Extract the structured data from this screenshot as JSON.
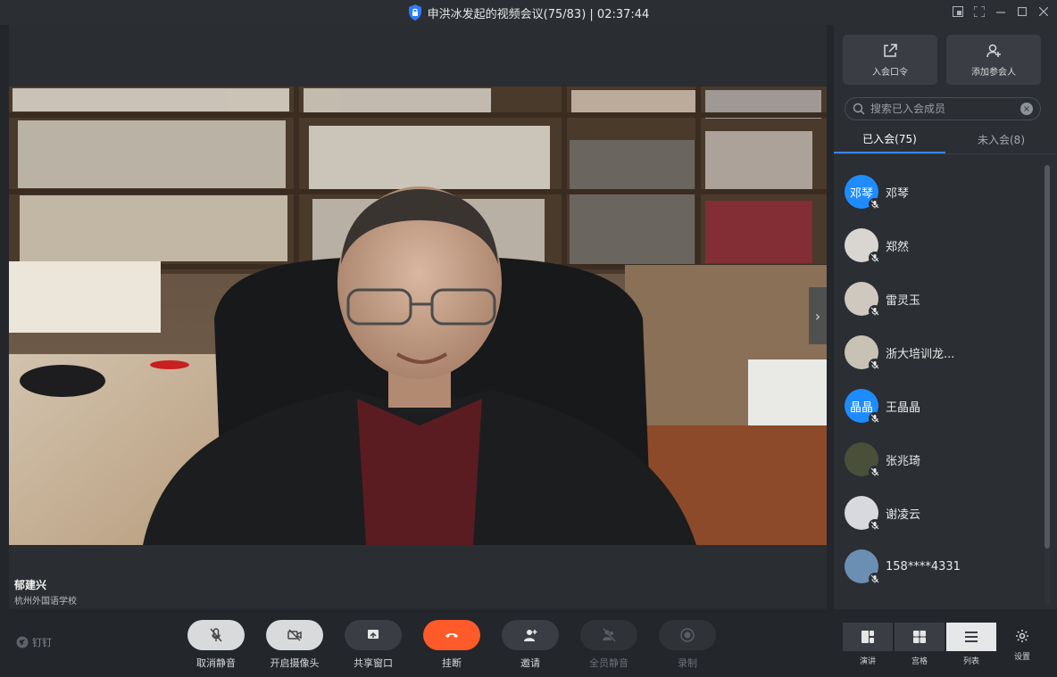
{
  "window": {
    "title": "申洪冰发起的视频会议(75/83) | 02:37:44",
    "controls": [
      "pip-icon",
      "fullscreen-icon",
      "minimize-icon",
      "maximize-icon",
      "close-icon"
    ]
  },
  "stage": {
    "speaker_name": "郁建兴",
    "speaker_org": "杭州外国语学校"
  },
  "side": {
    "buttons": [
      {
        "label": "入会口令",
        "icon": "share-out-icon"
      },
      {
        "label": "添加参会人",
        "icon": "add-user-icon"
      }
    ],
    "search_placeholder": "搜索已入会成员",
    "tabs": [
      {
        "label": "已入会(75)",
        "active": true
      },
      {
        "label": "未入会(8)",
        "active": false
      }
    ],
    "members": [
      {
        "name": "邓琴",
        "avatar_text": "邓琴",
        "avatar_color": "#1e8cff"
      },
      {
        "name": "郑然",
        "avatar_text": "",
        "avatar_color": "#d9d6d2"
      },
      {
        "name": "雷灵玉",
        "avatar_text": "",
        "avatar_color": "#cfc8bf"
      },
      {
        "name": "浙大培训龙...",
        "avatar_text": "",
        "avatar_color": "#c8c2b5"
      },
      {
        "name": "王晶晶",
        "avatar_text": "晶晶",
        "avatar_color": "#1e8cff"
      },
      {
        "name": "张兆琦",
        "avatar_text": "",
        "avatar_color": "#4a4f3a"
      },
      {
        "name": "谢凌云",
        "avatar_text": "",
        "avatar_color": "#d8d9de"
      },
      {
        "name": "158****4331",
        "avatar_text": "",
        "avatar_color": "#6b8fb3"
      }
    ]
  },
  "toolbar": {
    "brand": "钉钉",
    "tools": [
      {
        "label": "取消静音",
        "style": "light",
        "icon": "mic-off-icon"
      },
      {
        "label": "开启摄像头",
        "style": "light",
        "icon": "camera-off-icon"
      },
      {
        "label": "共享窗口",
        "style": "normal",
        "icon": "share-screen-icon"
      },
      {
        "label": "挂断",
        "style": "danger",
        "icon": "hangup-icon"
      },
      {
        "label": "邀请",
        "style": "normal",
        "icon": "invite-icon"
      },
      {
        "label": "全员静音",
        "style": "disabled",
        "icon": "mute-all-icon"
      },
      {
        "label": "录制",
        "style": "disabled",
        "icon": "record-icon"
      }
    ],
    "views": [
      {
        "label": "演讲",
        "active": false,
        "icon": "speaker-view-icon"
      },
      {
        "label": "宫格",
        "active": false,
        "icon": "grid-view-icon"
      },
      {
        "label": "列表",
        "active": true,
        "icon": "list-view-icon"
      }
    ],
    "settings_label": "设置"
  }
}
